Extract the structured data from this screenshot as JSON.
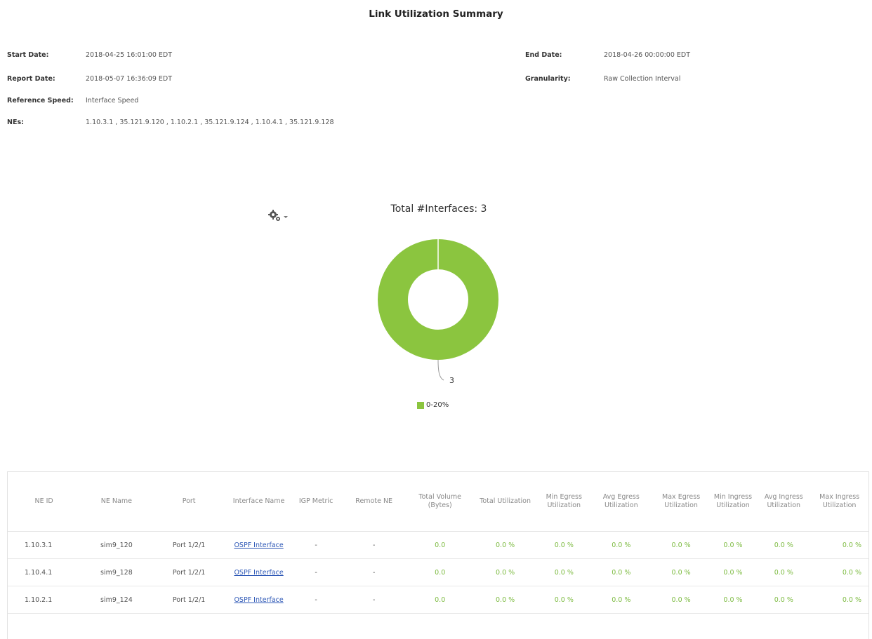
{
  "report": {
    "title": "Link Utilization Summary"
  },
  "meta": {
    "start_date_label": "Start Date:",
    "start_date_value": "2018-04-25 16:01:00 EDT",
    "report_date_label": "Report Date:",
    "report_date_value": "2018-05-07 16:36:09 EDT",
    "reference_speed_label": "Reference Speed:",
    "reference_speed_value": "Interface Speed",
    "nes_label": "NEs:",
    "nes_value": "1.10.3.1 , 35.121.9.120 , 1.10.2.1 , 35.121.9.124 , 1.10.4.1 , 35.121.9.128",
    "end_date_label": "End Date:",
    "end_date_value": "2018-04-26 00:00:00 EDT",
    "granularity_label": "Granularity:",
    "granularity_value": "Raw Collection Interval"
  },
  "chart_toolbar": {
    "icon": "gears-icon"
  },
  "chart_data": {
    "type": "pie",
    "title": "Total #Interfaces: 3",
    "donut": true,
    "categories": [
      "0-20%"
    ],
    "values": [
      3
    ],
    "data_labels": [
      "3"
    ],
    "colors": [
      "#8bc53f"
    ],
    "legend": "bottom"
  },
  "table": {
    "columns": [
      "NE ID",
      "NE Name",
      "Port",
      "Interface Name",
      "IGP Metric",
      "Remote NE",
      "Total Volume (Bytes)",
      "Total Utilization",
      "Min Egress Utilization",
      "Avg Egress Utilization",
      "Max Egress Utilization",
      "Min Ingress Utilization",
      "Avg Ingress Utilization",
      "Max Ingress Utilization"
    ],
    "rows": [
      [
        "1.10.3.1",
        "sim9_120",
        "Port 1/2/1",
        "OSPF Interface",
        "-",
        "-",
        "0.0",
        "0.0 %",
        "0.0 %",
        "0.0 %",
        "0.0 %",
        "0.0 %",
        "0.0 %",
        "0.0 %"
      ],
      [
        "1.10.4.1",
        "sim9_128",
        "Port 1/2/1",
        "OSPF Interface",
        "-",
        "-",
        "0.0",
        "0.0 %",
        "0.0 %",
        "0.0 %",
        "0.0 %",
        "0.0 %",
        "0.0 %",
        "0.0 %"
      ],
      [
        "1.10.2.1",
        "sim9_124",
        "Port 1/2/1",
        "OSPF Interface",
        "-",
        "-",
        "0.0",
        "0.0 %",
        "0.0 %",
        "0.0 %",
        "0.0 %",
        "0.0 %",
        "0.0 %",
        "0.0 %"
      ]
    ]
  }
}
